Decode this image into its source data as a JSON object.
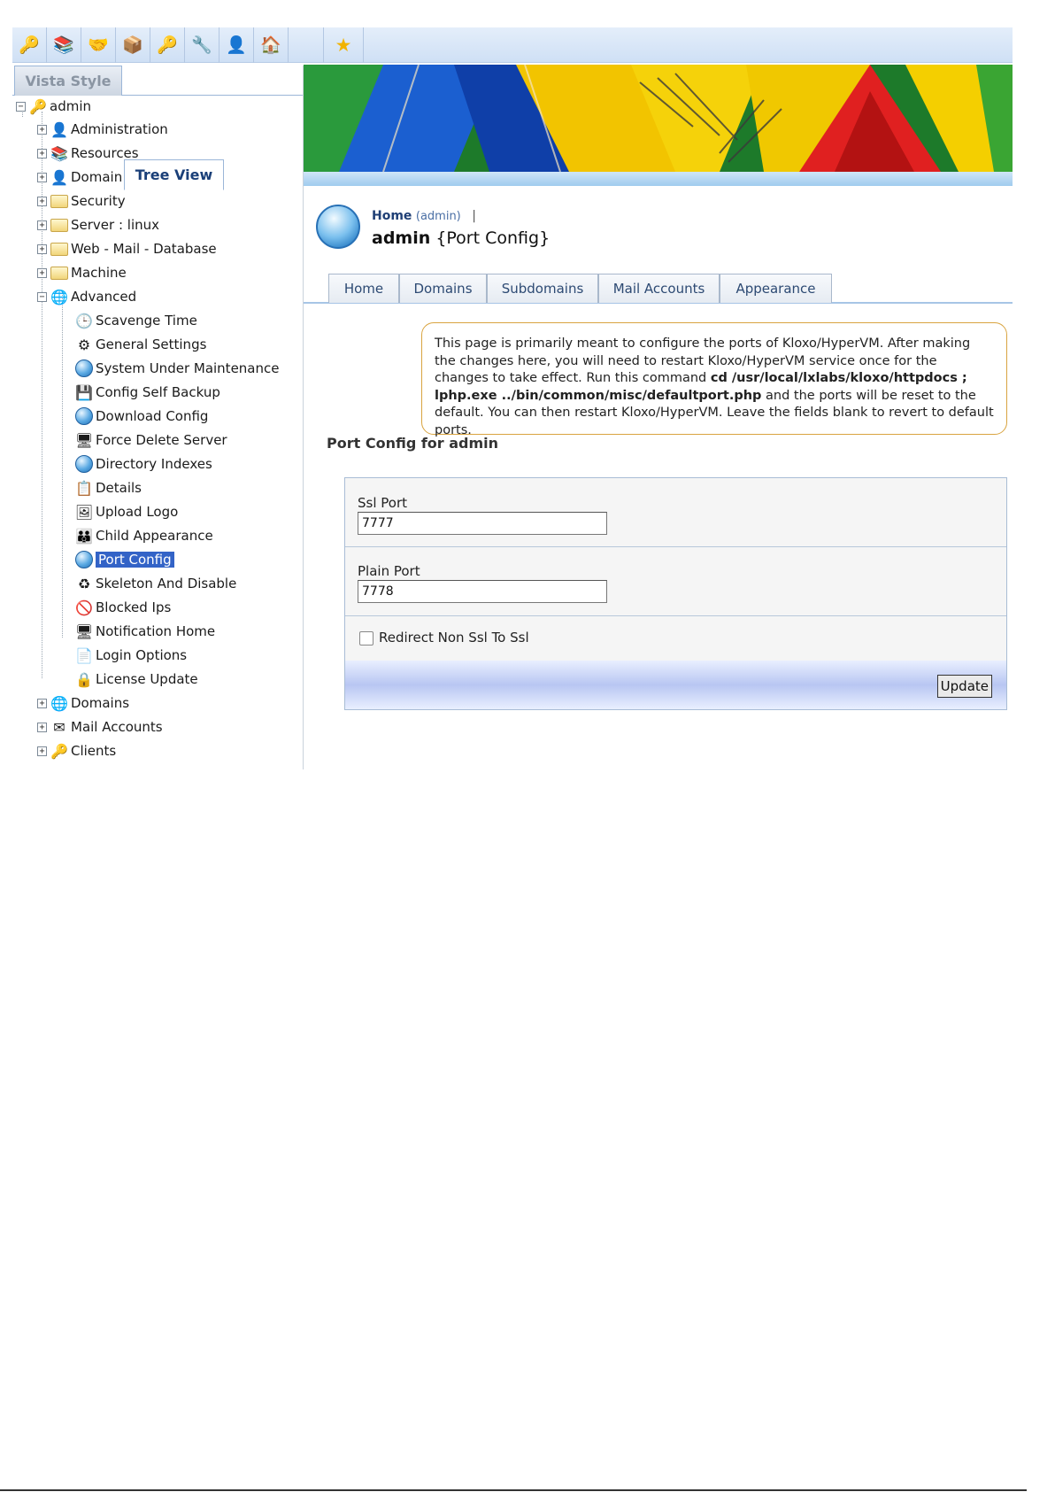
{
  "toolbar": {
    "buttons": [
      "key-user-icon",
      "resources-icon",
      "handshake-icon",
      "cube-icon",
      "key-user-icon",
      "tools-icon",
      "person-icon",
      "home-up-icon"
    ],
    "favorite_icon": "star-icon"
  },
  "left_tabs": {
    "vista": "Vista Style",
    "tree": "Tree View"
  },
  "tree": {
    "root": "admin",
    "top_items": [
      "Administration",
      "Resources",
      "Domain",
      "Security",
      "Server  : linux",
      "Web - Mail - Database",
      "Machine",
      "Advanced"
    ],
    "advanced_children": [
      "Scavenge Time",
      "General Settings",
      "System Under Maintenance",
      "Config Self Backup",
      "Download Config",
      "Force Delete Server",
      "Directory Indexes",
      "Details",
      "Upload Logo",
      "Child Appearance",
      "Port Config",
      "Skeleton And Disable",
      "Blocked Ips",
      "Notification Home",
      "Login Options",
      "License Update"
    ],
    "bottom_items": [
      "Domains",
      "Mail Accounts",
      "Clients"
    ],
    "selected": "Port Config"
  },
  "breadcrumb": {
    "home": "Home",
    "home_sub": "(admin)",
    "separator": "|"
  },
  "page_title": {
    "object": "admin",
    "action": "{Port Config}"
  },
  "main_tabs": [
    "Home",
    "Domains",
    "Subdomains",
    "Mail Accounts",
    "Appearance"
  ],
  "info": {
    "text1": "This page is primarily meant to configure the ports of Kloxo/HyperVM. After making the changes here, you will need to restart Kloxo/HyperVM service once for the changes to take effect. Run this command ",
    "command": "cd /usr/local/lxlabs/kloxo/httpdocs ; lphp.exe ../bin/common/misc/defaultport.php",
    "text2": " and the ports will be reset to the default. You can then restart Kloxo/HyperVM. Leave the fields blank to revert to default ports."
  },
  "section_title": "Port Config for admin",
  "form": {
    "ssl_label": "Ssl Port",
    "ssl_value": "7777",
    "plain_label": "Plain Port",
    "plain_value": "7778",
    "redirect_label": "Redirect Non Ssl To Ssl",
    "update_label": "Update"
  },
  "colors": {
    "accent": "#3363c7",
    "info_border": "#d9a440",
    "tab_text": "#2d4a73"
  }
}
